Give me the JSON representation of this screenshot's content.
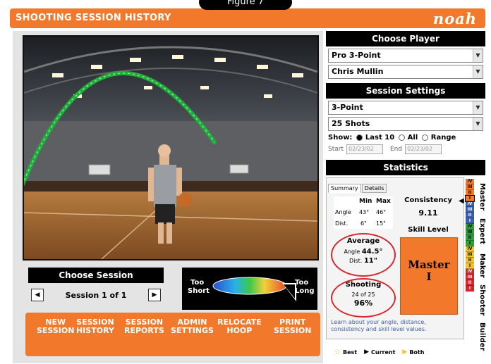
{
  "figure_label": "Figure 7",
  "app": {
    "title": "SHOOTING SESSION HISTORY",
    "logo": "noah"
  },
  "session_panel": {
    "title": "Choose Session",
    "prev_icon": "triangle-left",
    "next_icon": "triangle-right",
    "current": "Session 1 of 1"
  },
  "legend": {
    "left_label_1": "Too",
    "left_label_2": "Short",
    "right_label_1": "Too",
    "right_label_2": "Long"
  },
  "nav": {
    "items": [
      {
        "line1": "NEW",
        "line2": "SESSION"
      },
      {
        "line1": "SESSION",
        "line2": "HISTORY"
      },
      {
        "line1": "SESSION",
        "line2": "REPORTS"
      },
      {
        "line1": "ADMIN",
        "line2": "SETTINGS"
      },
      {
        "line1": "RELOCATE",
        "line2": "HOOP"
      },
      {
        "line1": "PRINT",
        "line2": "SESSION"
      }
    ]
  },
  "choose_player": {
    "title": "Choose Player",
    "group_select": "Pro 3-Point",
    "player_select": "Chris Mullin"
  },
  "session_settings": {
    "title": "Session Settings",
    "shot_type": "3-Point",
    "shot_count": "25 Shots",
    "show_label": "Show:",
    "show_options": [
      "Last 10",
      "All",
      "Range"
    ],
    "show_selected": "Last 10",
    "start_label": "Start",
    "start_value": "02/23/02",
    "end_label": "End",
    "end_value": "02/23/02"
  },
  "statistics": {
    "title": "Statistics",
    "tabs": [
      "Summary",
      "Details"
    ],
    "active_tab": "Summary",
    "min_label": "Min",
    "max_label": "Max",
    "angle_label": "Angle",
    "angle_min": "43°",
    "angle_max": "46°",
    "dist_label": "Dist.",
    "dist_min": "6\"",
    "dist_max": "15\"",
    "consistency_label": "Consistency",
    "consistency_value": "9.11",
    "skill_label": "Skill Level",
    "skill_value_1": "Master",
    "skill_value_2": "I",
    "average_label": "Average",
    "avg_angle_label": "Angle",
    "avg_angle": "44.5°",
    "avg_dist_label": "Dist.",
    "avg_dist": "11\"",
    "shooting_label": "Shooting",
    "shooting_count": "24 of 25",
    "shooting_pct": "96%",
    "hint": "Learn about your angle, distance, consistency and skill level values."
  },
  "skill_ladder": {
    "levels": [
      "Master",
      "Expert",
      "Maker",
      "Shooter",
      "Builder"
    ],
    "colors": {
      "master": "#f2792b",
      "expert": "#3a5fb0",
      "maker": "#2e9e3e",
      "shooter": "#f2c230",
      "builder": "#d8262c"
    }
  },
  "footer": {
    "best": "Best",
    "current": "Current",
    "both": "Both"
  },
  "colors": {
    "accent": "#f2792b",
    "annotation_red": "#d8262c",
    "arc_green": "#1fae3a"
  }
}
